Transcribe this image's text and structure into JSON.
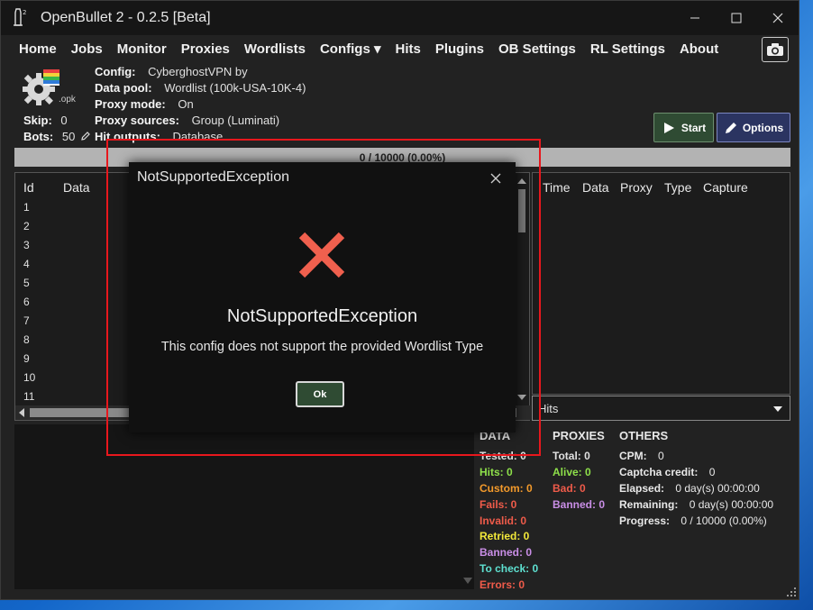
{
  "window": {
    "title": "OpenBullet 2 - 0.2.5 [Beta]"
  },
  "menu": [
    {
      "label": "Home"
    },
    {
      "label": "Jobs"
    },
    {
      "label": "Monitor"
    },
    {
      "label": "Proxies"
    },
    {
      "label": "Wordlists"
    },
    {
      "label": "Configs ▾"
    },
    {
      "label": "Hits"
    },
    {
      "label": "Plugins"
    },
    {
      "label": "OB Settings"
    },
    {
      "label": "RL Settings"
    },
    {
      "label": "About"
    }
  ],
  "job_info": {
    "config_label": "Config:",
    "config_value": "CyberghostVPN by",
    "datapool_label": "Data pool:",
    "datapool_value": "Wordlist (100k-USA-10K-4)",
    "proxymode_label": "Proxy mode:",
    "proxymode_value": "On",
    "proxysources_label": "Proxy sources:",
    "proxysources_value": "Group (Luminati)",
    "hitoutputs_label": "Hit outputs:",
    "hitoutputs_value": "Database",
    "skip_label": "Skip:",
    "skip_value": "0",
    "bots_label": "Bots:",
    "bots_value": "50",
    "logo_sub": ".opk"
  },
  "buttons": {
    "start": "Start",
    "options": "Options"
  },
  "progress_text": "0 / 10000 (0.00%)",
  "left_grid": {
    "columns": [
      "Id",
      "Data"
    ],
    "rows": [
      "1",
      "2",
      "3",
      "4",
      "5",
      "6",
      "7",
      "8",
      "9",
      "10",
      "11"
    ]
  },
  "right_grid": {
    "columns": [
      "Time",
      "Data",
      "Proxy",
      "Type",
      "Capture"
    ]
  },
  "hits_select": "Hits",
  "stats": {
    "data_head": "DATA",
    "proxies_head": "PROXIES",
    "others_head": "OTHERS",
    "tested": "Tested: 0",
    "hits": "Hits: 0",
    "custom": "Custom: 0",
    "fails": "Fails: 0",
    "invalid": "Invalid: 0",
    "retried": "Retried: 0",
    "banned": "Banned: 0",
    "tocheck": "To check: 0",
    "errors": "Errors: 0",
    "p_total": "Total: 0",
    "p_alive": "Alive: 0",
    "p_bad": "Bad: 0",
    "p_banned": "Banned: 0",
    "cpm_label": "CPM:",
    "cpm_value": "0",
    "captcha_label": "Captcha credit:",
    "captcha_value": "0",
    "elapsed_label": "Elapsed:",
    "elapsed_value": "0 day(s) 00:00:00",
    "remaining_label": "Remaining:",
    "remaining_value": "0 day(s) 00:00:00",
    "progress_label": "Progress:",
    "progress_value": "0 / 10000 (0.00%)"
  },
  "modal": {
    "title": "NotSupportedException",
    "heading": "NotSupportedException",
    "message": "This config does not support the provided Wordlist Type",
    "ok": "Ok"
  },
  "colors": {
    "hits": "#8ee04a",
    "custom": "#f39a2b",
    "fails": "#ef5b4a",
    "invalid": "#ef5b4a",
    "retried": "#f2e83a",
    "banned": "#c98ee6",
    "tocheck": "#5ee0d0",
    "errors": "#ef5b4a",
    "error_x": "#f0604e",
    "highlight": "#e8171d"
  }
}
